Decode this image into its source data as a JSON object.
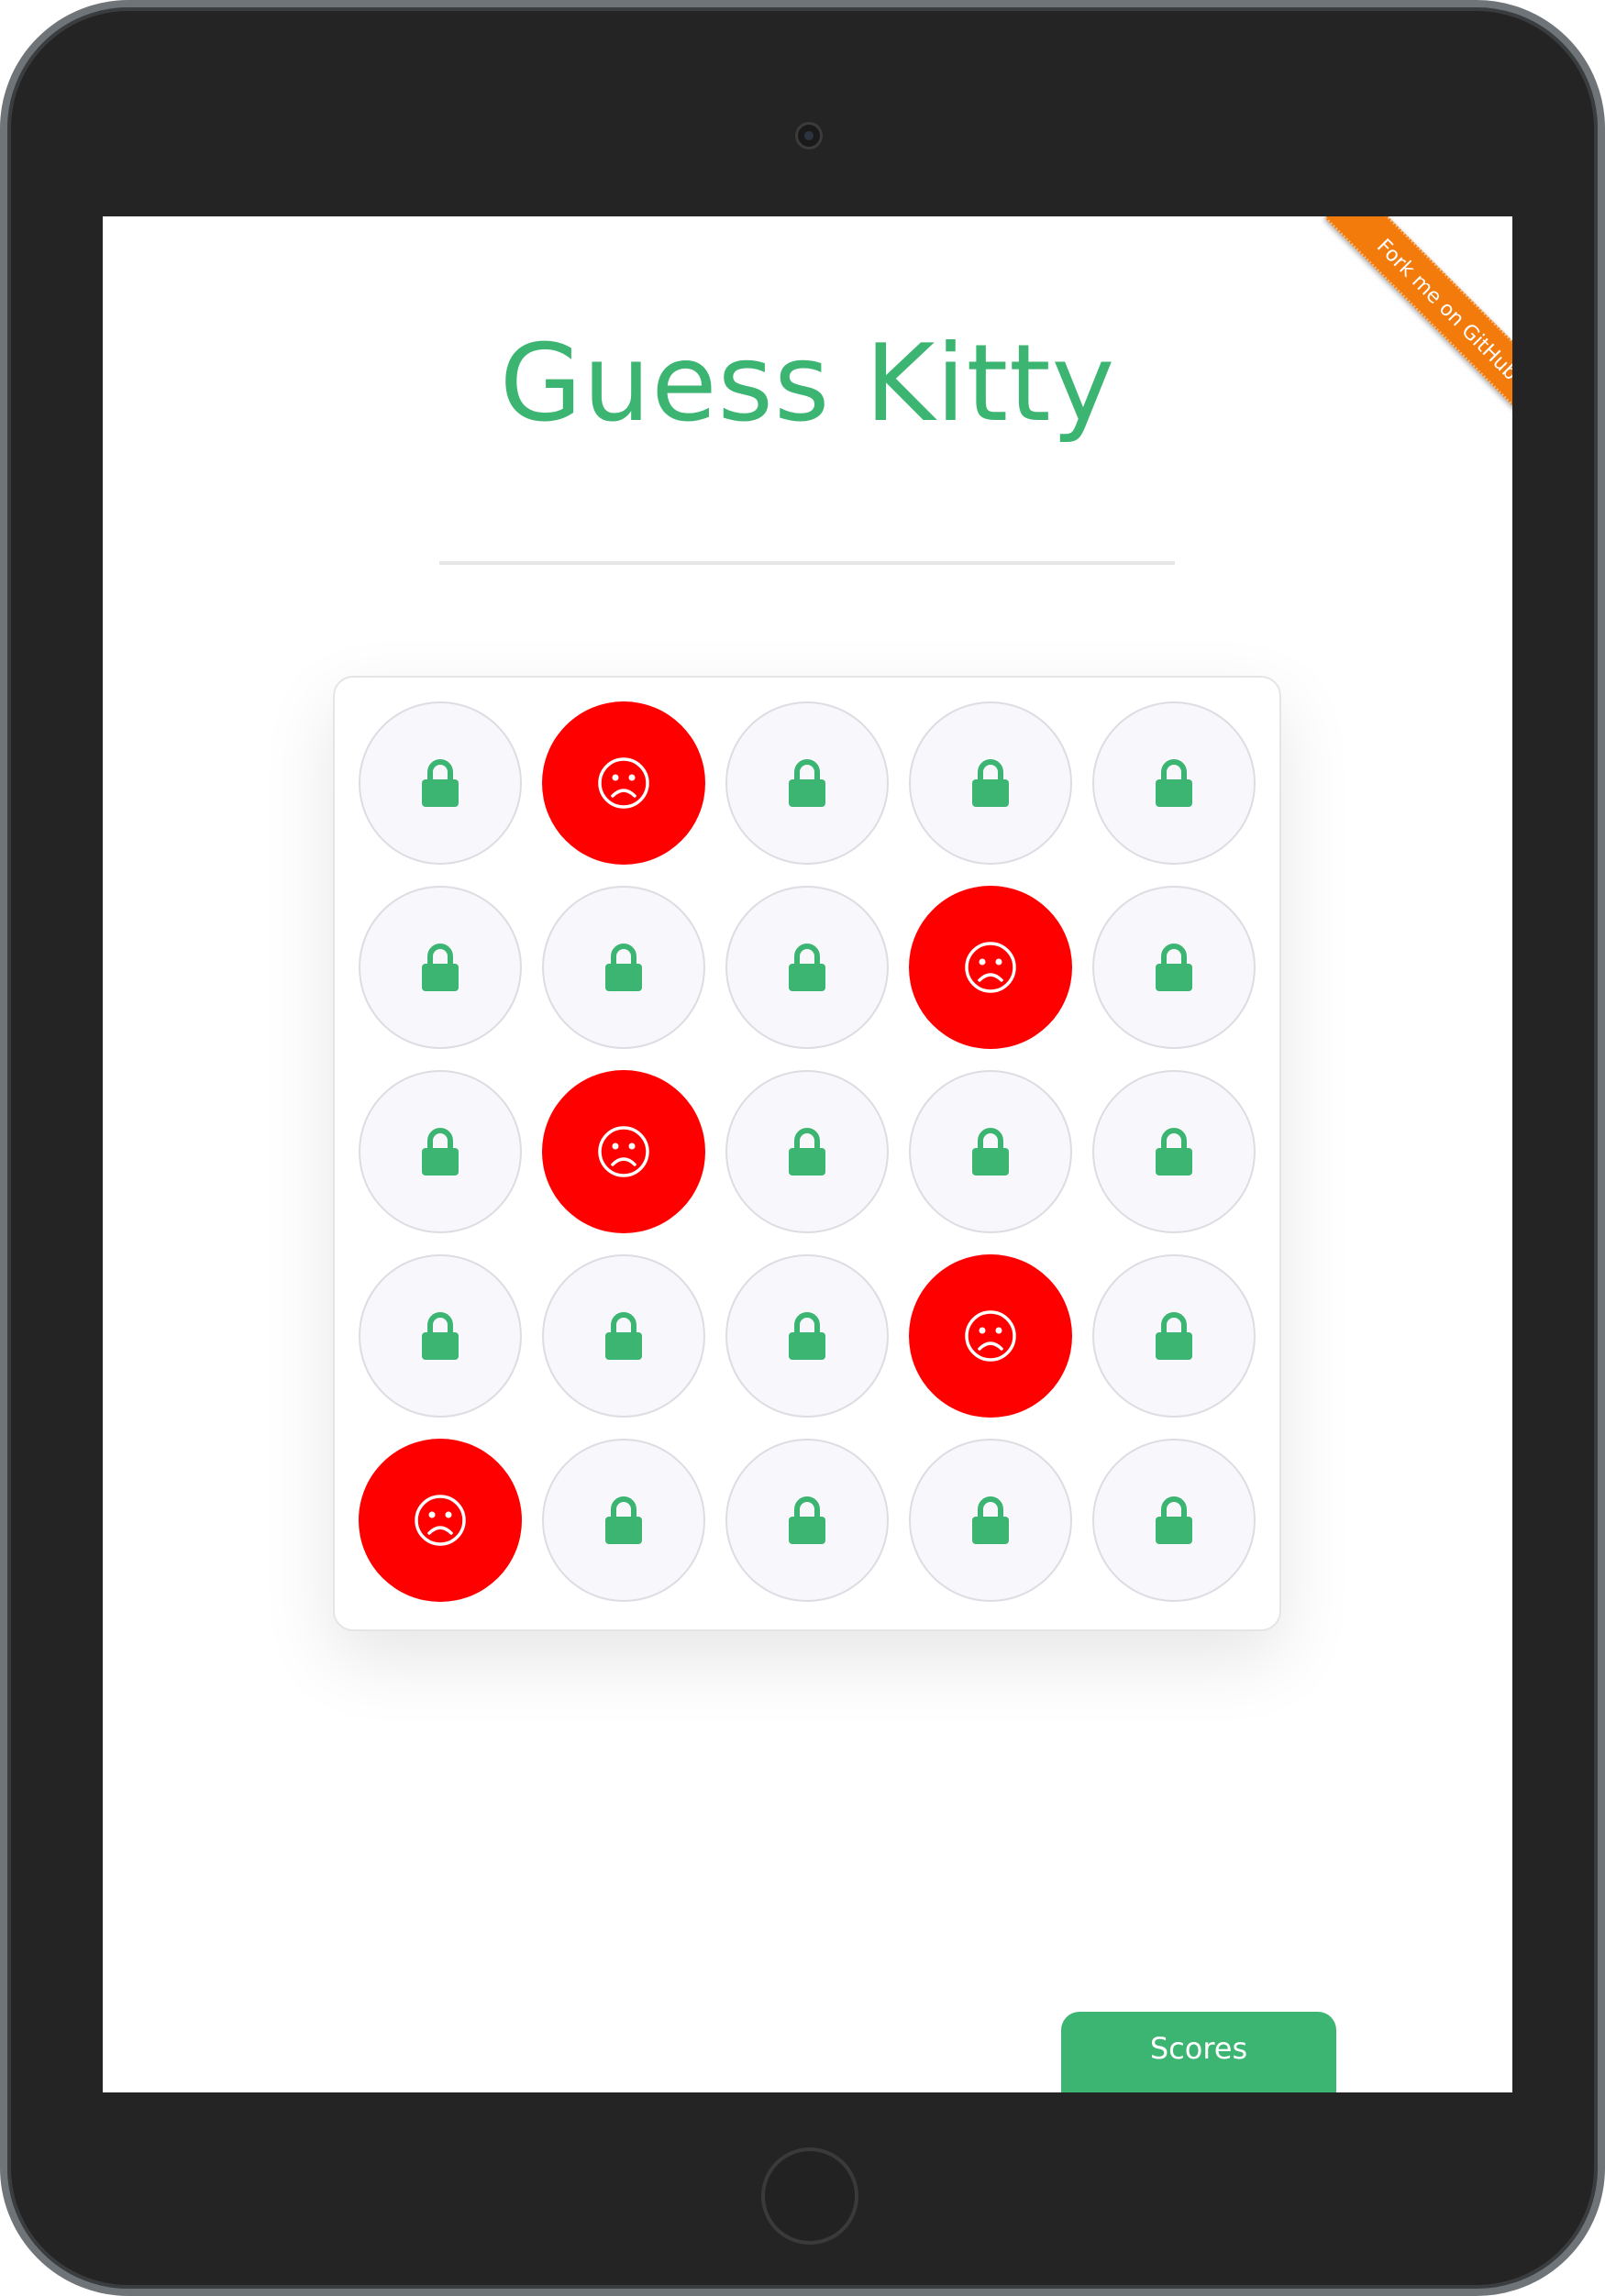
{
  "app": {
    "title": "Guess Kitty"
  },
  "ribbon": {
    "label": "Fork me on GitHub"
  },
  "board": {
    "rows": 5,
    "cols": 5,
    "cells": [
      [
        "locked",
        "missed",
        "locked",
        "locked",
        "locked"
      ],
      [
        "locked",
        "locked",
        "locked",
        "missed",
        "locked"
      ],
      [
        "locked",
        "missed",
        "locked",
        "locked",
        "locked"
      ],
      [
        "locked",
        "locked",
        "locked",
        "missed",
        "locked"
      ],
      [
        "missed",
        "locked",
        "locked",
        "locked",
        "locked"
      ]
    ]
  },
  "footer": {
    "scores_label": "Scores"
  },
  "colors": {
    "accent": "#3db572",
    "missed": "#ff0000",
    "ribbon": "#f27b0c"
  },
  "icons": {
    "locked": "lock-icon",
    "missed": "sad-face-icon"
  }
}
